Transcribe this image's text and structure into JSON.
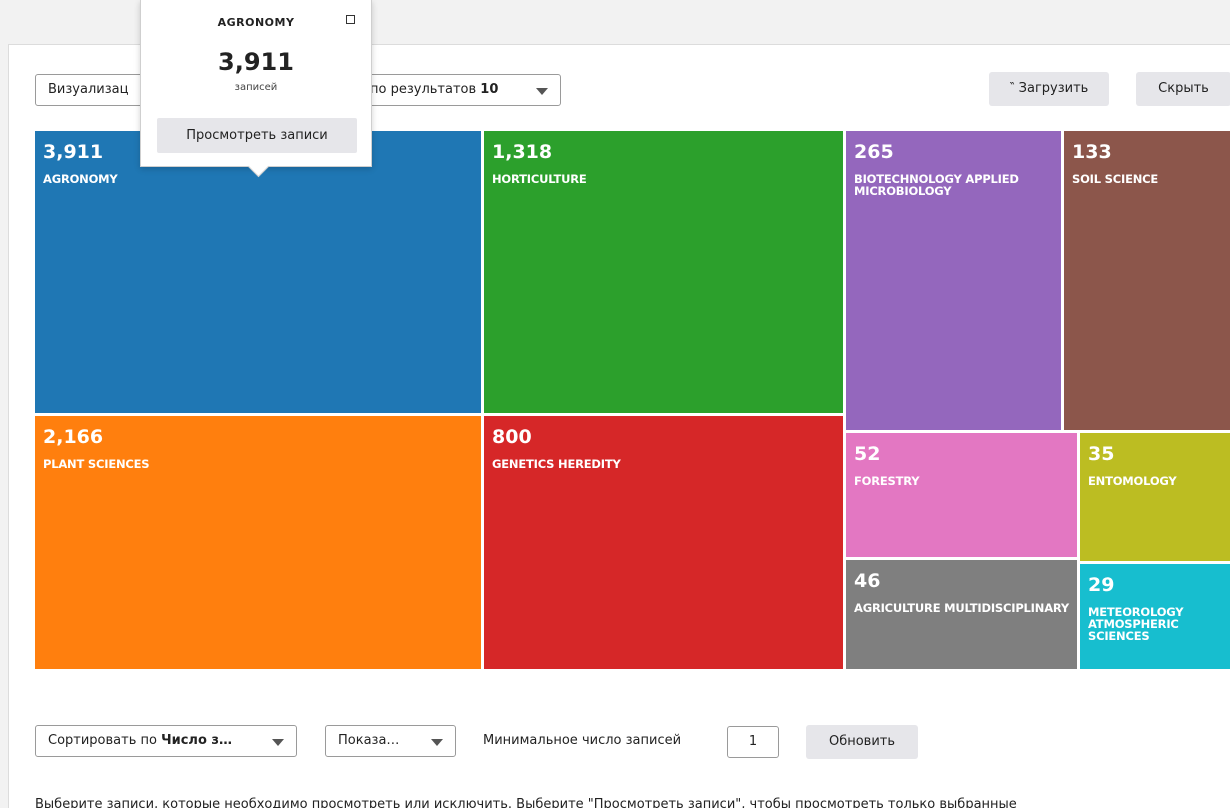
{
  "toolbar": {
    "viz_select_label": "Визуализац",
    "results_select_prefix": "по результатов",
    "results_select_value": "10",
    "download_icon": "‶",
    "download_label": "Загрузить",
    "hide_label": "Скрыть"
  },
  "tooltip": {
    "title": "AGRONOMY",
    "count": "3,911",
    "unit": "записей",
    "view_button": "Просмотреть записи"
  },
  "chart_data": {
    "type": "treemap",
    "items": [
      {
        "label": "AGRONOMY",
        "value": 3911,
        "display": "3,911",
        "color": "#1f77b4"
      },
      {
        "label": "PLANT SCIENCES",
        "value": 2166,
        "display": "2,166",
        "color": "#ff7f0e"
      },
      {
        "label": "HORTICULTURE",
        "value": 1318,
        "display": "1,318",
        "color": "#2ca02c"
      },
      {
        "label": "GENETICS HEREDITY",
        "value": 800,
        "display": "800",
        "color": "#d62728"
      },
      {
        "label": "BIOTECHNOLOGY APPLIED MICROBIOLOGY",
        "value": 265,
        "display": "265",
        "color": "#9467bd"
      },
      {
        "label": "SOIL SCIENCE",
        "value": 133,
        "display": "133",
        "color": "#8c564b"
      },
      {
        "label": "FORESTRY",
        "value": 52,
        "display": "52",
        "color": "#e377c2"
      },
      {
        "label": "ENTOMOLOGY",
        "value": 35,
        "display": "35",
        "color": "#bcbd22"
      },
      {
        "label": "AGRICULTURE MULTIDISCIPLINARY",
        "value": 46,
        "display": "46",
        "color": "#7f7f7f"
      },
      {
        "label": "METEOROLOGY ATMOSPHERIC SCIENCES",
        "value": 29,
        "display": "29",
        "color": "#17becf"
      }
    ]
  },
  "controls": {
    "sort_prefix": "Сортировать по",
    "sort_value": "Число з…",
    "show_label": "Показа…",
    "min_records_label": "Минимальное число записей",
    "min_records_value": "1",
    "refresh_label": "Обновить"
  },
  "footer": {
    "text": "Выберите записи, которые необходимо просмотреть или исключить. Выберите \"Просмотреть записи\", чтобы просмотреть только выбранные"
  }
}
